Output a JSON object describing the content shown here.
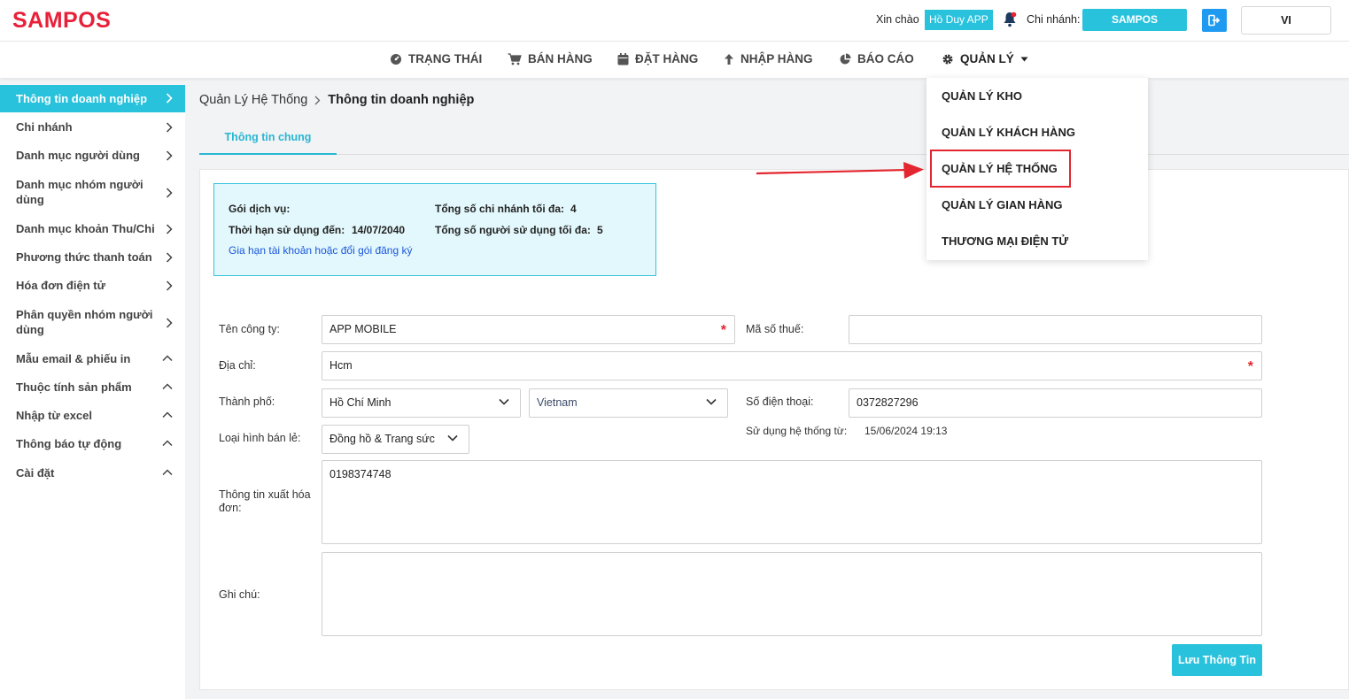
{
  "header": {
    "logo": "SAMPOS",
    "greeting": "Xin chào",
    "user_name": "Hồ Duy APP",
    "branch_label": "Chi nhánh:",
    "branch_value": "SAMPOS",
    "language": "VI"
  },
  "nav": {
    "items": [
      {
        "label": "TRẠNG THÁI",
        "icon": "dashboard-icon"
      },
      {
        "label": "BÁN HÀNG",
        "icon": "cart-icon"
      },
      {
        "label": "ĐẶT HÀNG",
        "icon": "calendar-icon"
      },
      {
        "label": "NHẬP HÀNG",
        "icon": "arrow-up-icon"
      },
      {
        "label": "BÁO CÁO",
        "icon": "pie-chart-icon"
      },
      {
        "label": "QUẢN LÝ",
        "icon": "gear-icon"
      }
    ]
  },
  "dropdown": {
    "items": [
      "QUẢN LÝ KHO",
      "QUẢN LÝ KHÁCH HÀNG",
      "QUẢN LÝ HỆ THỐNG",
      "QUẢN LÝ GIAN HÀNG",
      "THƯƠNG MẠI ĐIỆN TỬ"
    ],
    "highlighted": "QUẢN LÝ HỆ THỐNG"
  },
  "sidebar": {
    "items": [
      {
        "label": "Thông tin doanh nghiệp"
      },
      {
        "label": "Chi nhánh"
      },
      {
        "label": "Danh mục người dùng"
      },
      {
        "label": "Danh mục nhóm người dùng"
      },
      {
        "label": "Danh mục khoản Thu/Chi"
      },
      {
        "label": "Phương thức thanh toán"
      },
      {
        "label": "Hóa đơn điện tử"
      },
      {
        "label": "Phân quyền nhóm người dùng"
      },
      {
        "label": "Mẫu email & phiếu in"
      },
      {
        "label": "Thuộc tính sản phẩm"
      },
      {
        "label": "Nhập từ excel"
      },
      {
        "label": "Thông báo tự động"
      },
      {
        "label": "Cài đặt"
      }
    ]
  },
  "breadcrumb": {
    "parent": "Quản Lý Hệ Thống",
    "current": "Thông tin doanh nghiệp"
  },
  "tabs": {
    "general": "Thông tin chung"
  },
  "service": {
    "package_label": "Gói dịch vụ:",
    "expiry_label": "Thời hạn sử dụng đến:",
    "expiry_value": "14/07/2040",
    "renew_link": "Gia hạn tài khoản hoặc đổi gói đăng ký",
    "max_branches_label": "Tổng số chi nhánh tối đa:",
    "max_branches_value": "4",
    "max_users_label": "Tổng số người sử dụng tối đa:",
    "max_users_value": "5"
  },
  "form": {
    "company_label": "Tên công ty:",
    "company_value": "APP MOBILE",
    "tax_label": "Mã số thuế:",
    "tax_value": "",
    "address_label": "Địa chỉ:",
    "address_value": "Hcm",
    "city_label": "Thành phố:",
    "city_value": "Hồ Chí Minh",
    "country_value": "Vietnam",
    "phone_label": "Số điện thoại:",
    "phone_value": "0372827296",
    "retail_type_label": "Loại hình bán lẻ:",
    "retail_type_value": "Đồng hồ & Trang sức",
    "since_label": "Sử dụng hệ thống từ:",
    "since_value": "15/06/2024 19:13",
    "invoice_label": "Thông tin xuất hóa đơn:",
    "invoice_value": "0198374748",
    "note_label": "Ghi chú:",
    "note_value": "",
    "required_mark": "*"
  },
  "actions": {
    "save": "Lưu Thông Tin"
  },
  "colors": {
    "brand": "#e8213a",
    "accent": "#29c2dc",
    "highlight": "#e3262f"
  }
}
